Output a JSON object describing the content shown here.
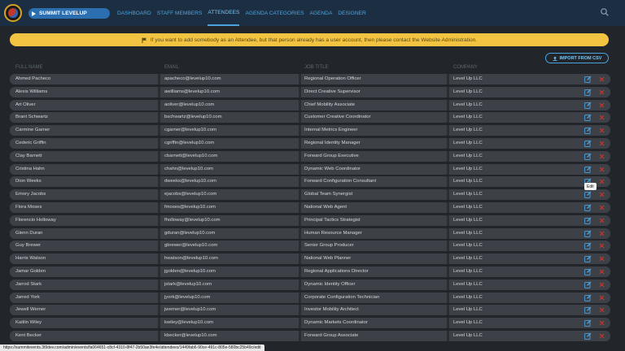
{
  "header": {
    "event_name": "SUMMIT LEVELUP",
    "nav": [
      {
        "label": "DASHBOARD",
        "active": false
      },
      {
        "label": "STAFF MEMBERS",
        "active": false
      },
      {
        "label": "ATTENDEES",
        "active": true
      },
      {
        "label": "AGENDA CATEGORIES",
        "active": false
      },
      {
        "label": "AGENDA",
        "active": false
      },
      {
        "label": "DESIGNER",
        "active": false
      }
    ]
  },
  "notice": "If you want to add somebody as an Attendee, but that person already has a user account, then please contact the Website Administration.",
  "import_button": "IMPORT FROM CSV",
  "columns": [
    "FULL NAME",
    "EMAIL",
    "JOB TITLE",
    "COMPANY"
  ],
  "attendees": [
    {
      "name": "Ahmed Pacheco",
      "email": "apacheco@levelup10.com",
      "title": "Regional Operation Officer",
      "company": "Level Up LLC"
    },
    {
      "name": "Alexis Williams",
      "email": "awilliams@levelup10.com",
      "title": "Direct Creative Supervisor",
      "company": "Level Up LLC"
    },
    {
      "name": "Art Oliver",
      "email": "aoliver@levelup10.com",
      "title": "Chief Mobility Associate",
      "company": "Level Up LLC"
    },
    {
      "name": "Brant Schwartz",
      "email": "bschwartz@levelup10.com",
      "title": "Customer Creative Coordinator",
      "company": "Level Up LLC"
    },
    {
      "name": "Carmine Garner",
      "email": "cgarner@levelup10.com",
      "title": "Internal Metrics Engineer",
      "company": "Level Up LLC"
    },
    {
      "name": "Cederic Griffin",
      "email": "cgriffin@levelup10.com",
      "title": "Regional Identity Manager",
      "company": "Level Up LLC"
    },
    {
      "name": "Clay Barnett",
      "email": "cbarnett@levelup10.com",
      "title": "Forward Group Executive",
      "company": "Level Up LLC"
    },
    {
      "name": "Cristina Hahn",
      "email": "chahn@levelup10.com",
      "title": "Dynamic Web Coordinator",
      "company": "Level Up LLC"
    },
    {
      "name": "Dion Weeks",
      "email": "dweeks@levelup10.com",
      "title": "Forward Configuration Consultant",
      "company": "Level Up LLC"
    },
    {
      "name": "Emory Jacobs",
      "email": "ejacobs@levelup10.com",
      "title": "Global Team Synergist",
      "company": "Level Up LLC"
    },
    {
      "name": "Flora Moses",
      "email": "fmoses@levelup10.com",
      "title": "National Web Agent",
      "company": "Level Up LLC"
    },
    {
      "name": "Florencio Holloway",
      "email": "fholloway@levelup10.com",
      "title": "Principal Tactics Strategist",
      "company": "Level Up LLC"
    },
    {
      "name": "Glenn Duran",
      "email": "gduran@levelup10.com",
      "title": "Human Resource Manager",
      "company": "Level Up LLC"
    },
    {
      "name": "Guy Brewer",
      "email": "gbrewer@levelup10.com",
      "title": "Senior Group Producer",
      "company": "Level Up LLC"
    },
    {
      "name": "Harris Watson",
      "email": "hwatson@levelup10.com",
      "title": "National Web Planner",
      "company": "Level Up LLC"
    },
    {
      "name": "Jamar Golden",
      "email": "jgolden@levelup10.com",
      "title": "Regional Applications Director",
      "company": "Level Up LLC"
    },
    {
      "name": "Jarrod Stark",
      "email": "jstark@levelup10.com",
      "title": "Dynamic Identity Officer",
      "company": "Level Up LLC"
    },
    {
      "name": "Jarred York",
      "email": "jyork@levelup10.com",
      "title": "Corporate Configuration Technician",
      "company": "Level Up LLC"
    },
    {
      "name": "Jewell Werner",
      "email": "jwerner@levelup10.com",
      "title": "Investor Mobility Architect",
      "company": "Level Up LLC"
    },
    {
      "name": "Kaitlin Wiley",
      "email": "kwiley@levelup10.com",
      "title": "Dynamic Markets Coordinator",
      "company": "Level Up LLC"
    },
    {
      "name": "Kent Becker",
      "email": "kbecker@levelup10.com",
      "title": "Forward Group Associate",
      "company": "Level Up LLC"
    }
  ],
  "tooltip": "Edit",
  "status_url": "https://summitevents.3t9dev.com/admin/events/fa064651-c8cf-4310-8f47-2b50ae3fe4e/attendees/1449fab6-90ce-491c-805e-580bc25b49c/edit",
  "colors": {
    "accent": "#4aa3df",
    "notice": "#f3c442",
    "delete": "#c0392b"
  },
  "icons": {
    "search": "search-icon",
    "edit": "edit-icon",
    "delete": "close-icon",
    "flag": "flag-icon",
    "upload": "upload-icon"
  }
}
